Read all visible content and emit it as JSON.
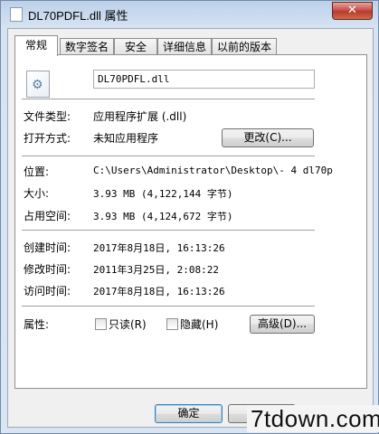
{
  "window": {
    "title": "DL70PDFL.dll 属性",
    "close_glyph": "✕"
  },
  "tabs": [
    {
      "label": "常规",
      "active": true
    },
    {
      "label": "数字签名",
      "active": false
    },
    {
      "label": "安全",
      "active": false
    },
    {
      "label": "详细信息",
      "active": false
    },
    {
      "label": "以前的版本",
      "active": false
    }
  ],
  "general": {
    "file_name": "DL70PDFL.dll",
    "file_type_label": "文件类型:",
    "file_type_value": "应用程序扩展 (.dll)",
    "open_with_label": "打开方式:",
    "open_with_value": "未知应用程序",
    "change_button": "更改(C)...",
    "location_label": "位置:",
    "location_value": "C:\\Users\\Administrator\\Desktop\\- 4 dl70p",
    "size_label": "大小:",
    "size_value": "3.93 MB (4,122,144 字节)",
    "size_on_disk_label": "占用空间:",
    "size_on_disk_value": "3.93 MB (4,124,672 字节)",
    "created_label": "创建时间:",
    "created_value": "2017年8月18日, 16:13:26",
    "modified_label": "修改时间:",
    "modified_value": "2011年3月25日, 2:08:22",
    "accessed_label": "访问时间:",
    "accessed_value": "2017年8月18日, 16:13:26",
    "attributes_label": "属性:",
    "readonly_label": "只读(R)",
    "hidden_label": "隐藏(H)",
    "advanced_button": "高级(D)..."
  },
  "footer": {
    "ok_button": "确定"
  },
  "watermark": "7tdown.com",
  "icons": {
    "file_icon": "gear-file-icon"
  }
}
